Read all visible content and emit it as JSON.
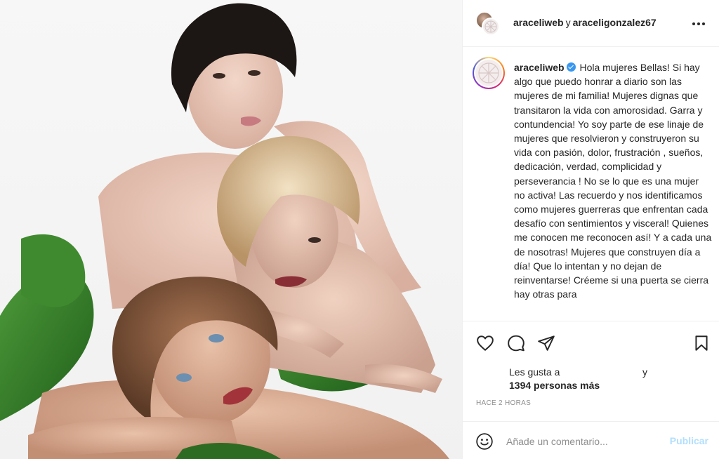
{
  "post": {
    "header": {
      "user1": "araceliweb",
      "conjunction": "y",
      "user2": "araceligonzalez67"
    },
    "caption": {
      "user": "araceliweb",
      "text": "Hola mujeres Bellas! Si hay algo que puedo honrar a diario son las mujeres de mi familia! Mujeres dignas que transitaron la vida con amorosidad. Garra y contundencia! Yo soy parte de ese linaje de mujeres que resolvieron y construyeron su vida con pasión, dolor, frustración , sueños, dedicación, verdad, complicidad y perseverancia ! No se lo que es una mujer no activa! Las recuerdo y nos identificamos como mujeres guerreras que enfrentan cada desafío con sentimientos y visceral! Quienes me conocen me reconocen así! Y a cada una de nosotras! Mujeres que construyen día a día! Que lo intentan y no dejan de reinventarse! Créeme si una puerta se cierra hay otras para"
    },
    "likes": {
      "prefix": "Les gusta a",
      "conjunction": "y",
      "count_text": "1394 personas más"
    },
    "timestamp": "HACE 2 HORAS",
    "comment": {
      "placeholder": "Añade un comentario...",
      "value": "",
      "publish_label": "Publicar"
    },
    "icons": {
      "more": "more-options-icon",
      "like": "heart-icon",
      "comment": "comment-icon",
      "share": "paper-plane-icon",
      "save": "bookmark-icon",
      "emoji": "smiley-icon",
      "verified": "verified-badge-icon"
    },
    "colors": {
      "publish_disabled": "#b2dffc",
      "verified": "#3897f0",
      "muted": "#8e8e8e",
      "text": "#262626"
    }
  }
}
